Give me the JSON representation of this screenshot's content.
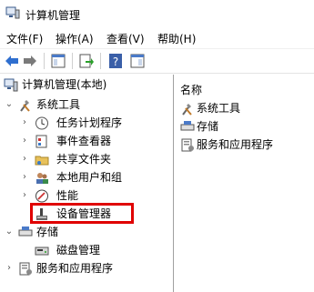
{
  "window": {
    "title": "计算机管理"
  },
  "menu": [
    "文件(F)",
    "操作(A)",
    "查看(V)",
    "帮助(H)"
  ],
  "toolbar": {
    "buttons": [
      "back-button",
      "forward-button",
      "show-hide-console-tree-button",
      "export-list-button",
      "help-button",
      "show-hide-action-pane-button"
    ]
  },
  "tree": {
    "root": "计算机管理(本地)",
    "system_tools": "系统工具",
    "task_scheduler": "任务计划程序",
    "event_viewer": "事件查看器",
    "shared_folders": "共享文件夹",
    "local_users": "本地用户和组",
    "performance": "性能",
    "device_manager": "设备管理器",
    "storage": "存储",
    "disk_management": "磁盘管理",
    "services_apps": "服务和应用程序"
  },
  "right": {
    "header": "名称",
    "items": [
      "系统工具",
      "存储",
      "服务和应用程序"
    ]
  },
  "colors": {
    "highlight": "#e00000",
    "accent_blue": "#2f6fcf"
  }
}
